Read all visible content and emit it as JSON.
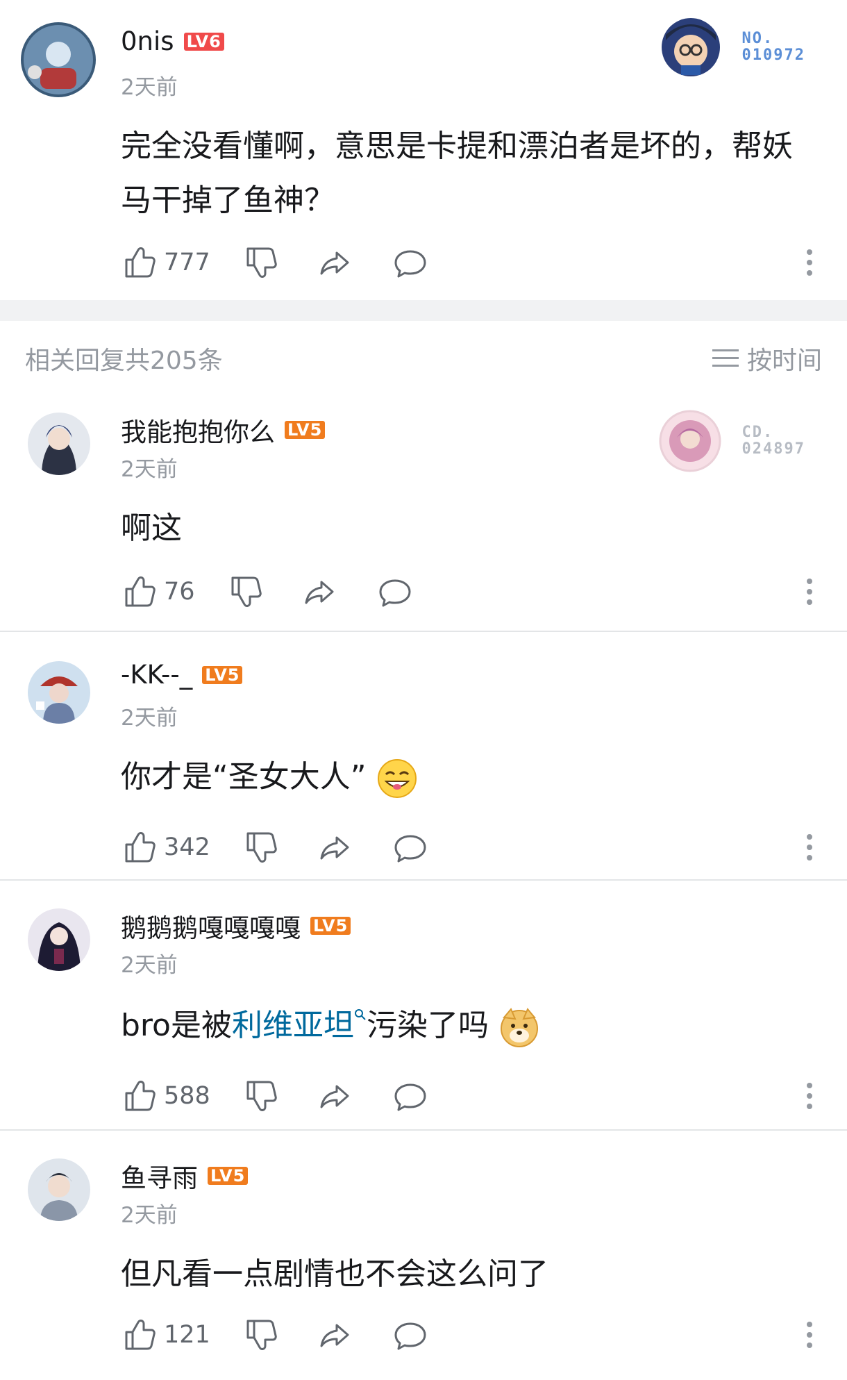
{
  "main_comment": {
    "username": "0nis",
    "level": "LV6",
    "time": "2天前",
    "text": "完全没看懂啊，意思是卡提和漂泊者是坏的，帮妖马干掉了鱼神？",
    "likes": "777",
    "fan_badge": {
      "prefix": "NO.",
      "number": "010972"
    }
  },
  "reply_header": {
    "count_label": "相关回复共205条",
    "sort_label": "按时间"
  },
  "replies": [
    {
      "username": "我能抱抱你么",
      "level": "LV5",
      "time": "2天前",
      "text": "啊这",
      "likes": "76",
      "fan_badge": {
        "prefix": "CD.",
        "number": "024897"
      }
    },
    {
      "username": "-KK--_",
      "level": "LV5",
      "time": "2天前",
      "text": "你才是“圣女大人”",
      "likes": "342",
      "emoji": "grin-emoji"
    },
    {
      "username": "鹅鹅鹅嘎嘎嘎嘎",
      "level": "LV5",
      "time": "2天前",
      "text_before": "bro是被",
      "keyword": "利维亚坦",
      "text_after": "污染了吗",
      "likes": "588",
      "emoji": "doge-emoji"
    },
    {
      "username": "鱼寻雨",
      "level": "LV5",
      "time": "2天前",
      "text": "但凡看一点剧情也不会这么问了",
      "likes": "121"
    }
  ],
  "colors": {
    "accent_level": "#f07c1e",
    "level6": "#f04a4a",
    "keyword": "#00699d",
    "muted": "#9499a0"
  }
}
